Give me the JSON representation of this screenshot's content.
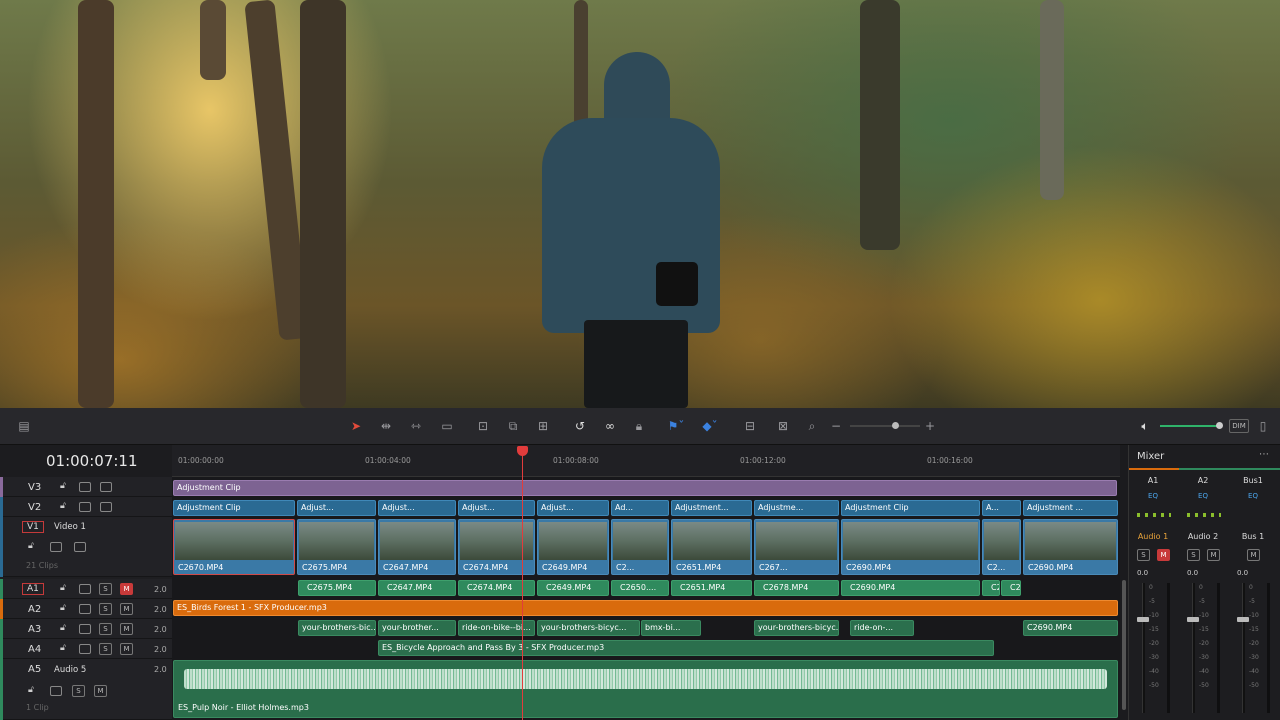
{
  "topbar": {
    "dim_label": "DIM"
  },
  "timeline": {
    "timecode": "01:00:07:11",
    "ruler_ticks": [
      "01:00:00:00",
      "01:00:04:00",
      "01:00:08:00",
      "01:00:12:00",
      "01:00:16:00"
    ],
    "tracks": [
      {
        "id": "V3",
        "name": "",
        "clips_count": ""
      },
      {
        "id": "V2",
        "name": "",
        "clips_count": ""
      },
      {
        "id": "V1",
        "name": "Video 1",
        "clips_count": "21 Clips"
      },
      {
        "id": "A1",
        "name": "",
        "vol": "2.0"
      },
      {
        "id": "A2",
        "name": "",
        "vol": "2.0"
      },
      {
        "id": "A3",
        "name": "",
        "vol": "2.0"
      },
      {
        "id": "A4",
        "name": "",
        "vol": "2.0"
      },
      {
        "id": "A5",
        "name": "Audio 5",
        "vol": "2.0",
        "clips_count": "1 Clip"
      }
    ],
    "v3_clip": "Adjustment Clip",
    "v2_clips": [
      "Adjustment Clip",
      "Adjust...",
      "Adjust...",
      "Adjust...",
      "Adjust...",
      "Ad...",
      "Adjustment...",
      "Adjustme...",
      "Adjustment Clip",
      "A...",
      "Adjustment ..."
    ],
    "v1_clips": [
      "C2670.MP4",
      "C2675.MP4",
      "C2647.MP4",
      "C2674.MP4",
      "C2649.MP4",
      "C2...",
      "C2651.MP4",
      "C267...",
      "C2690.MP4",
      "C2...",
      "C2690.MP4"
    ],
    "a1_clips": [
      "C2675.MP4",
      "C2647.MP4",
      "C2674.MP4",
      "C2649.MP4",
      "C2650....",
      "C2651.MP4",
      "C2678.MP4",
      "C2690.MP4",
      "C2...",
      "C2..."
    ],
    "a2_clip": "ES_Birds Forest 1 - SFX Producer.mp3",
    "a3_clips": [
      "your-brothers-bic...",
      "your-brother...",
      "ride-on-bike--bi...",
      "your-brothers-bicyc...",
      "bmx-bi...",
      "your-brothers-bicyc...",
      "ride-on-...",
      "C2690.MP4"
    ],
    "a4_clip": "ES_Bicycle Approach and Pass By 3 - SFX Producer.mp3",
    "a5_clip": "ES_Pulp Noir - Elliot Holmes.mp3"
  },
  "mixer": {
    "title": "Mixer",
    "channels": [
      {
        "top": "A1",
        "bottom": "Audio 1",
        "eq": "EQ"
      },
      {
        "top": "A2",
        "bottom": "Audio 2",
        "eq": "EQ"
      },
      {
        "top": "Bus1",
        "bottom": "Bus 1",
        "eq": "EQ"
      }
    ],
    "db_value": "0.0",
    "scale": [
      "0",
      "-5",
      "-10",
      "-15",
      "-20",
      "-30",
      "-40",
      "-50"
    ]
  },
  "colors": {
    "playhead": "#e23c3c",
    "adjustment": "#2a6a93",
    "audio": "#2f8a5d",
    "orange": "#d96b0d",
    "purple": "#8a6a9c"
  }
}
